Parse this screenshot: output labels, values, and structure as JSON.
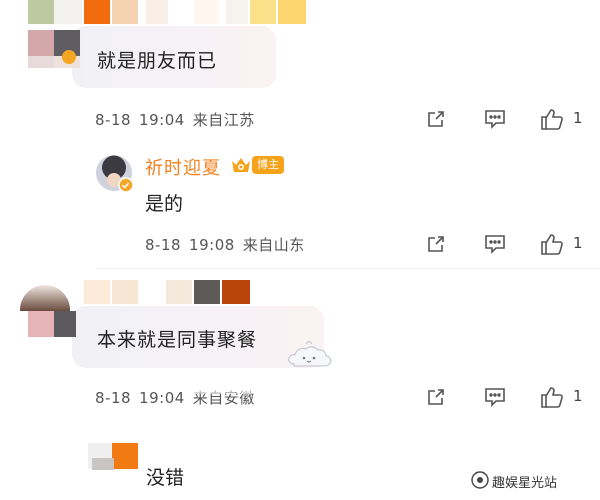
{
  "comments": [
    {
      "text": "就是朋友而已",
      "date": "8-18",
      "time": "19:04",
      "location": "来自江苏",
      "likes": "1",
      "reply": {
        "username": "祈时迎夏",
        "badge": "博主",
        "text": "是的",
        "date": "8-18",
        "time": "19:08",
        "location": "来自山东",
        "likes": "1"
      }
    },
    {
      "text": "本来就是同事聚餐",
      "date": "8-18",
      "time": "19:04",
      "location": "来自安徽",
      "likes": "1"
    },
    {
      "text": "没错"
    }
  ],
  "watermark": "趣娱星光站",
  "colors": {
    "username": "#f5821f",
    "badge": "#f7a31a",
    "bubble": "#f3f1f5"
  },
  "icons": [
    "share-icon",
    "comment-icon",
    "like-icon",
    "vip-crown-icon",
    "cloud-sticker-icon"
  ]
}
